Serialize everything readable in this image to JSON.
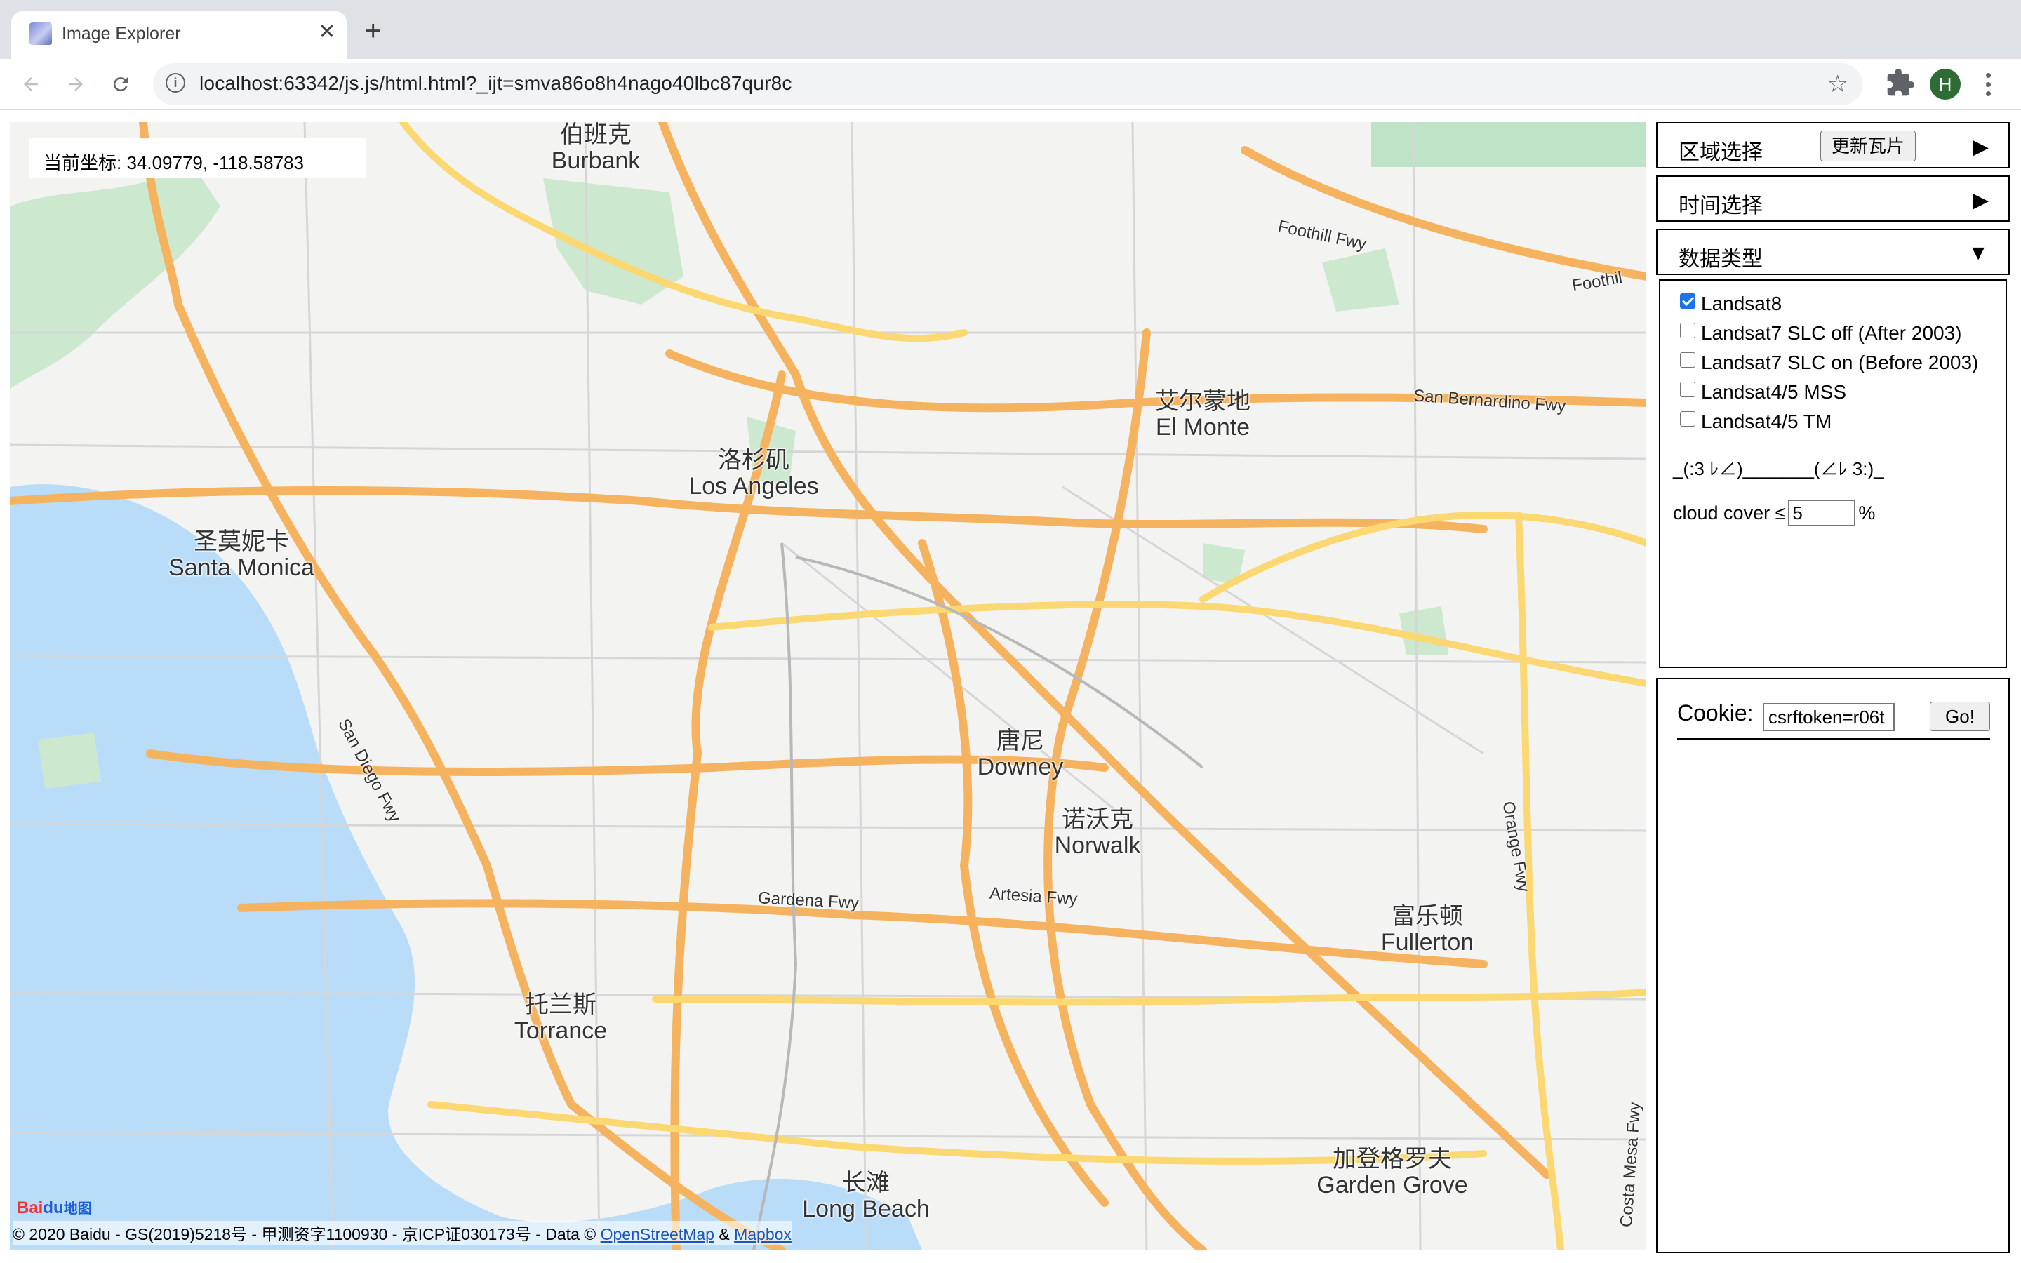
{
  "browser": {
    "tab_title": "Image Explorer",
    "tab_close": "✕",
    "new_tab": "+",
    "url": "localhost:63342/js.js/html.html?_ijt=smva86o8h4nago40lbc87qur8c",
    "avatar_letter": "H",
    "star_glyph": "☆"
  },
  "map": {
    "coord_label": "当前坐标: 34.09779, -118.58783",
    "labels": [
      {
        "zh": "伯班克",
        "en": "Burbank"
      },
      {
        "zh": "艾尔蒙地",
        "en": "El Monte"
      },
      {
        "zh": "洛杉矶",
        "en": "Los Angeles"
      },
      {
        "zh": "圣莫妮卡",
        "en": "Santa Monica"
      },
      {
        "zh": "唐尼",
        "en": "Downey"
      },
      {
        "zh": "诺沃克",
        "en": "Norwalk"
      },
      {
        "zh": "富乐顿",
        "en": "Fullerton"
      },
      {
        "zh": "托兰斯",
        "en": "Torrance"
      },
      {
        "zh": "加登格罗夫",
        "en": "Garden Grove"
      },
      {
        "zh": "长滩",
        "en": "Long Beach"
      }
    ],
    "roads": [
      "Foothill Fwy",
      "Foothil",
      "San Bernardino Fwy",
      "San Diego Fwy",
      "Gardena Fwy",
      "Artesia Fwy",
      "Orange Fwy",
      "Costa Mesa Fwy"
    ],
    "logo": {
      "part1": "Bai",
      "part2": "du",
      "part3": "地图"
    },
    "attribution": {
      "prefix": "© 2020 Baidu - GS(2019)5218号 - 甲测资字1100930 - 京ICP证030173号 - Data ©",
      "osm": "OpenStreetMap",
      "amp": "&",
      "mapbox": "Mapbox"
    }
  },
  "panel": {
    "region": {
      "title": "区域选择",
      "button": "更新瓦片",
      "arrow": "▶"
    },
    "time": {
      "title": "时间选择",
      "arrow": "▶"
    },
    "datatype": {
      "title": "数据类型",
      "arrow": "▼"
    },
    "options": [
      {
        "label": "Landsat8",
        "checked": true
      },
      {
        "label": "Landsat7 SLC off (After 2003)",
        "checked": false
      },
      {
        "label": "Landsat7 SLC on (Before 2003)",
        "checked": false
      },
      {
        "label": "Landsat4/5 MSS",
        "checked": false
      },
      {
        "label": "Landsat4/5 TM",
        "checked": false
      }
    ],
    "kaomoji": "_(:3 ﾚ∠)_______(∠ﾚ 3:)_",
    "cloud": {
      "label": "cloud cover ≤",
      "value": "5",
      "unit": "%"
    },
    "cookie": {
      "label": "Cookie:",
      "value": "csrftoken=r06t",
      "button": "Go!"
    }
  }
}
